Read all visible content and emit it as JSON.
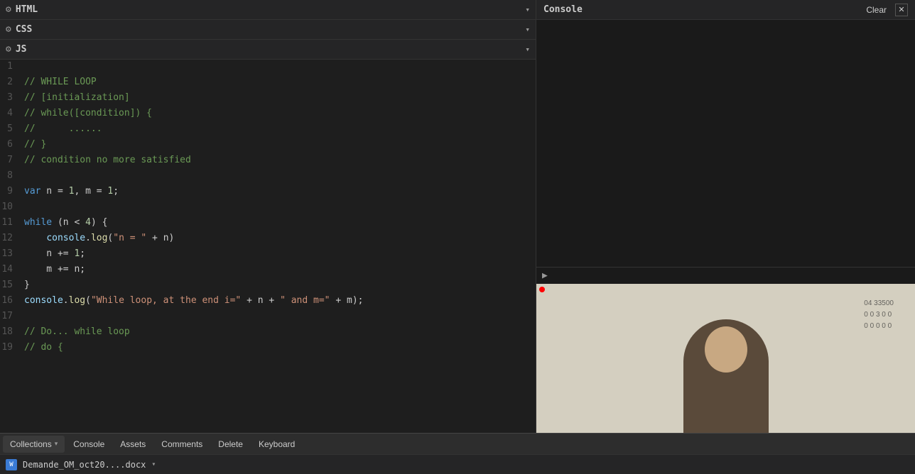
{
  "sections": {
    "html": {
      "title": "HTML",
      "chevron": "▾"
    },
    "css": {
      "title": "CSS",
      "chevron": "▾"
    },
    "js": {
      "title": "JS",
      "chevron": "▾"
    }
  },
  "console": {
    "title": "Console",
    "clear_label": "Clear",
    "close_label": "✕",
    "prompt_arrow": "▶"
  },
  "code_lines": [
    {
      "num": "1",
      "content": ""
    },
    {
      "num": "2",
      "content": "// WHILE LOOP"
    },
    {
      "num": "3",
      "content": "// [initialization]"
    },
    {
      "num": "4",
      "content": "// while([condition]) {"
    },
    {
      "num": "5",
      "content": "//      ......"
    },
    {
      "num": "6",
      "content": "// }"
    },
    {
      "num": "7",
      "content": "// condition no more satisfied"
    },
    {
      "num": "8",
      "content": ""
    },
    {
      "num": "9",
      "content": "var n = 1, m = 1;"
    },
    {
      "num": "10",
      "content": ""
    },
    {
      "num": "11",
      "content": "while (n < 4) {"
    },
    {
      "num": "12",
      "content": "    console.log(\"n = \" + n)"
    },
    {
      "num": "13",
      "content": "    n += 1;"
    },
    {
      "num": "14",
      "content": "    m += n;"
    },
    {
      "num": "15",
      "content": "}"
    },
    {
      "num": "16",
      "content": "console.log(\"While loop, at the end i=\" + n + \" and m=\" + m);"
    },
    {
      "num": "17",
      "content": ""
    },
    {
      "num": "18",
      "content": "// Do... while loop"
    },
    {
      "num": "19",
      "content": "// do {"
    }
  ],
  "toolbar": {
    "collections_label": "Collections",
    "console_label": "Console",
    "assets_label": "Assets",
    "comments_label": "Comments",
    "delete_label": "Delete",
    "keyboard_label": "Keyboard"
  },
  "status_bar": {
    "file_name": "Demande_OM_oct20....docx",
    "file_icon": "W"
  }
}
